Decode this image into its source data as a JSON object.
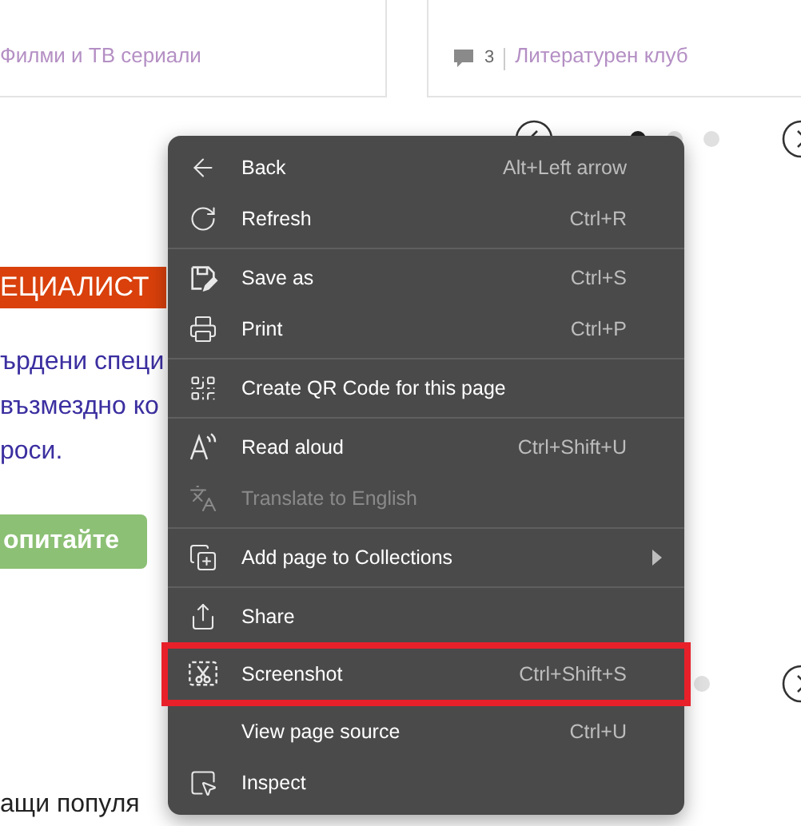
{
  "cards": [
    {
      "category": "Филми и ТВ сериали"
    },
    {
      "comments": "3",
      "category": "Литературен клуб"
    }
  ],
  "carousel_top": {
    "dots": [
      {
        "selected": true
      },
      {
        "selected": false
      },
      {
        "selected": false
      }
    ]
  },
  "banner": "ЕЦИАЛИСТ",
  "paragraph_lines": [
    "ърдени специ",
    "възмездно ко",
    "роси."
  ],
  "cta_button": "опитайте",
  "carousel_bottom": {
    "dots": [
      {
        "selected": false
      }
    ]
  },
  "heading": "ащи популя",
  "context_menu": {
    "items": [
      {
        "kind": "item",
        "label": "Back",
        "shortcut": "Alt+Left arrow",
        "disabled": false,
        "highlighted": false
      },
      {
        "kind": "item",
        "label": "Refresh",
        "shortcut": "Ctrl+R",
        "disabled": false,
        "highlighted": false
      },
      {
        "kind": "separator"
      },
      {
        "kind": "item",
        "label": "Save as",
        "shortcut": "Ctrl+S",
        "disabled": false,
        "highlighted": false
      },
      {
        "kind": "item",
        "label": "Print",
        "shortcut": "Ctrl+P",
        "disabled": false,
        "highlighted": false
      },
      {
        "kind": "separator"
      },
      {
        "kind": "item",
        "label": "Create QR Code for this page",
        "disabled": false,
        "highlighted": false
      },
      {
        "kind": "separator"
      },
      {
        "kind": "item",
        "label": "Read aloud",
        "shortcut": "Ctrl+Shift+U",
        "disabled": false,
        "highlighted": false
      },
      {
        "kind": "item",
        "label": "Translate to English",
        "disabled": true,
        "highlighted": false
      },
      {
        "kind": "separator"
      },
      {
        "kind": "item",
        "label": "Add page to Collections",
        "disabled": false,
        "highlighted": false,
        "submenu": true
      },
      {
        "kind": "separator"
      },
      {
        "kind": "item",
        "label": "Share",
        "disabled": false,
        "highlighted": false
      },
      {
        "kind": "item",
        "label": "Screenshot",
        "shortcut": "Ctrl+Shift+S",
        "disabled": false,
        "highlighted": true
      },
      {
        "kind": "item",
        "label": "View page source",
        "shortcut": "Ctrl+U",
        "disabled": false,
        "highlighted": false
      },
      {
        "kind": "item",
        "label": "Inspect",
        "disabled": false,
        "highlighted": false
      }
    ]
  }
}
